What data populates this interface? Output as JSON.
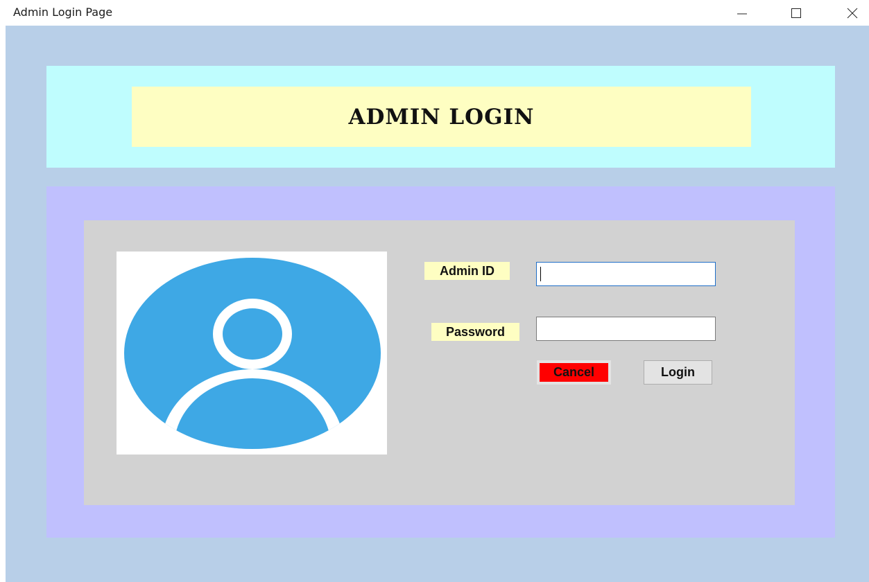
{
  "window": {
    "title": "Admin Login Page",
    "controls": {
      "minimize": "minimize-icon",
      "maximize": "maximize-icon",
      "close": "close-icon"
    }
  },
  "header": {
    "title": "ADMIN LOGIN"
  },
  "form": {
    "admin_id_label": "Admin ID",
    "admin_id_value": "",
    "password_label": "Password",
    "password_value": "",
    "cancel_label": "Cancel",
    "login_label": "Login"
  },
  "avatar": {
    "icon": "user-avatar-icon"
  },
  "colors": {
    "background": "#b8cfe8",
    "header_panel": "#bffdfe",
    "header_label": "#fefec2",
    "outer_panel": "#c0c0fe",
    "inner_panel": "#d2d2d2",
    "avatar_blue": "#3ea8e5",
    "cancel_button": "#ff0000"
  }
}
